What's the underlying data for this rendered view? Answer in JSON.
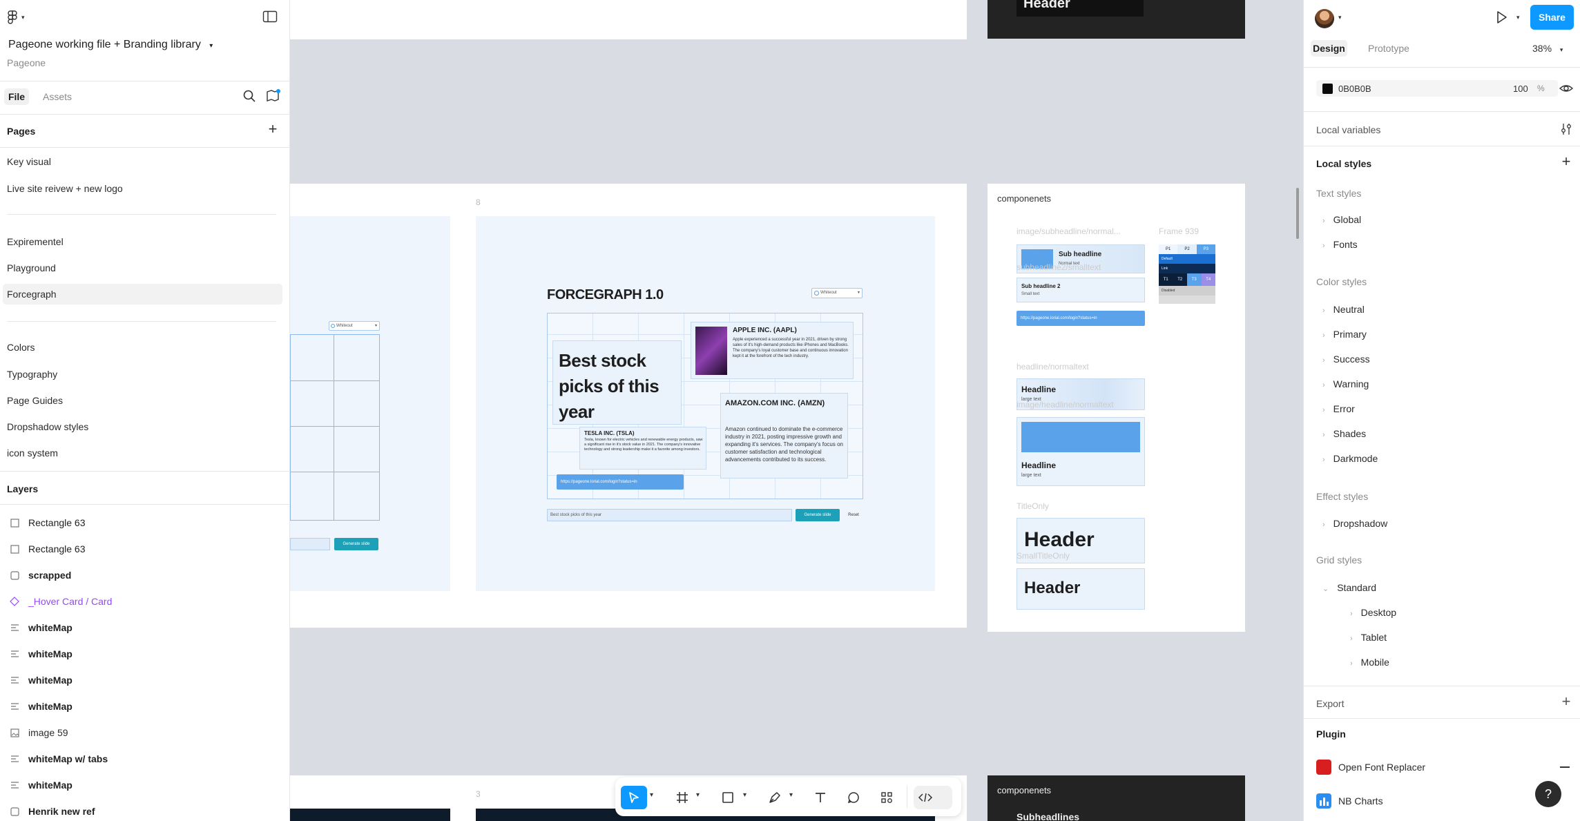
{
  "file": {
    "title": "Pageone working file + Branding library",
    "project": "Pageone"
  },
  "left_tabs": {
    "file": "File",
    "assets": "Assets"
  },
  "pages_header": "Pages",
  "pages": [
    "Key visual",
    "Live site reivew + new logo",
    "Expirementel",
    "Playground",
    "Forcegraph",
    "Colors",
    "Typography",
    "Page Guides",
    "Dropshadow styles",
    "icon system"
  ],
  "layers_header": "Layers",
  "layers": [
    {
      "name": "Rectangle 63",
      "icon": "rectangle-icon"
    },
    {
      "name": "Rectangle 63",
      "icon": "rectangle-icon"
    },
    {
      "name": "scrapped",
      "icon": "frame-icon"
    },
    {
      "name": "_Hover Card / Card",
      "icon": "component-icon"
    },
    {
      "name": "whiteMap",
      "icon": "text-layer-icon"
    },
    {
      "name": "whiteMap",
      "icon": "text-layer-icon"
    },
    {
      "name": "whiteMap",
      "icon": "text-layer-icon"
    },
    {
      "name": "whiteMap",
      "icon": "text-layer-icon"
    },
    {
      "name": "image 59",
      "icon": "image-icon"
    },
    {
      "name": "whiteMap w/ tabs",
      "icon": "text-layer-icon"
    },
    {
      "name": "whiteMap",
      "icon": "text-layer-icon"
    },
    {
      "name": "Henrik new ref",
      "icon": "frame-icon"
    }
  ],
  "right": {
    "share": "Share",
    "tabs": {
      "design": "Design",
      "prototype": "Prototype"
    },
    "zoom": "38%",
    "fill": {
      "hex": "0B0B0B",
      "opacity": "100",
      "unit": "%"
    },
    "local_variables": "Local variables",
    "local_styles": "Local styles",
    "text_styles": "Text styles",
    "text_style_items": [
      "Global",
      "Fonts"
    ],
    "color_styles": "Color styles",
    "color_style_items": [
      "Neutral",
      "Primary",
      "Success",
      "Warning",
      "Error",
      "Shades",
      "Darkmode"
    ],
    "effect_styles": "Effect styles",
    "effect_style_items": [
      "Dropshadow"
    ],
    "grid_styles": "Grid styles",
    "grid_standard": "Standard",
    "grid_items": [
      "Desktop",
      "Tablet",
      "Mobile"
    ],
    "export": "Export",
    "plugin": "Plugin",
    "plugins": [
      "Open Font Replacer",
      "NB Charts"
    ],
    "help": "?"
  },
  "canvas": {
    "frame_label_top": "8",
    "frame_label_bottom": "3",
    "top_dark_header": "Header",
    "forcegraph_title": "FORCEGRAPH 1.0",
    "dropdown_value": "Whiteout",
    "big_title": "Best stock picks of this year",
    "apple_title": "APPLE INC. (AAPL)",
    "apple_text": "Apple experienced a successful year in 2021, driven by strong sales of it's high-demand products like iPhones and MacBooks. The company's loyal customer base and continuous innovation kept it at the forefront of the tech industry.",
    "amazon_title": "AMAZON.COM INC. (AMZN)",
    "amazon_text": "Amazon continued to dominate the e-commerce industry in 2021, posting impressive growth and expanding it's services. The company's focus on customer satisfaction and technological advancements contributed to its success.",
    "tesla_title": "TESLA INC. (TSLA)",
    "tesla_text": "Tesla, known for electric vehicles and renewable energy products, saw a significant rise in it's stock value in 2021. The company's innovative technology and strong leadership make it a favorite among investors.",
    "url_bar": "https://pageone.lorial.com/login?status=in",
    "search_value": "Best stock picks of this year",
    "generate_btn": "Generate slide",
    "reset_btn": "Reset",
    "components_title": "componenets",
    "comp_labels": {
      "image_sub": "image/subheadline/normal...",
      "frame939": "Frame 939",
      "sub2": "subheadline2/smalltext",
      "headline_normal": "headline/normaltext",
      "image_headline": "image/headline/normaltext",
      "title_only": "TitleOnly",
      "small_title_only": "SmallTitleOnly"
    },
    "comp_texts": {
      "sub_headline": "Sub headline",
      "normal_text": "Normal text",
      "sub_headline_2": "Sub headline 2",
      "small_text": "Small text",
      "headline": "Headline",
      "large_text": "large text",
      "header": "Header",
      "tabs": [
        "P1",
        "P2",
        "P3"
      ],
      "tabs2": [
        "T1",
        "T2",
        "T3",
        "T4"
      ],
      "disabled": "Disabled",
      "default": "Default",
      "link": "Link"
    },
    "bottom_components_title": "componenets",
    "bottom_sub": "Subheadlines"
  },
  "colors": {
    "accent": "#0d99ff",
    "teal": "#1da1b8",
    "blue": "#5aa2ea",
    "dark": "#232323"
  }
}
